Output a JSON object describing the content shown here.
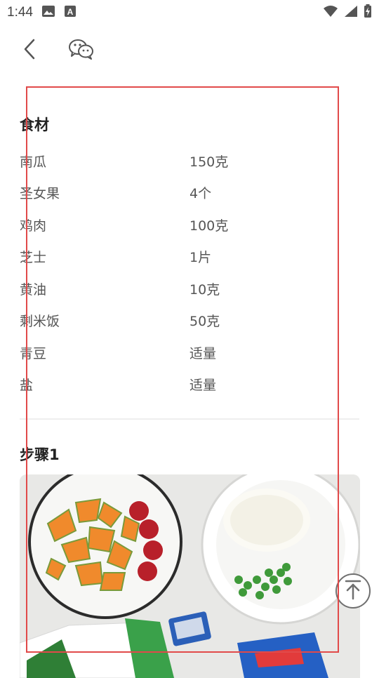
{
  "status_bar": {
    "time": "1:44",
    "icons": [
      "image-icon",
      "a-notification-icon",
      "wifi-icon",
      "signal-icon",
      "battery-charging-icon"
    ]
  },
  "toolbar": {
    "back_icon": "chevron-left-icon",
    "share_icon": "wechat-icon"
  },
  "ingredients": {
    "title": "食材",
    "items": [
      {
        "name": "南瓜",
        "qty": "150克"
      },
      {
        "name": "圣女果",
        "qty": "4个"
      },
      {
        "name": "鸡肉",
        "qty": "100克"
      },
      {
        "name": "芝士",
        "qty": "1片"
      },
      {
        "name": "黄油",
        "qty": "10克"
      },
      {
        "name": "剩米饭",
        "qty": "50克"
      },
      {
        "name": "青豆",
        "qty": "适量"
      },
      {
        "name": "盐",
        "qty": "适量"
      }
    ]
  },
  "steps": [
    {
      "title": "步骤1",
      "image": "food-photo"
    }
  ],
  "colors": {
    "selection_border": "#e14a4a",
    "text_primary": "#222222",
    "text_secondary": "#555555"
  }
}
